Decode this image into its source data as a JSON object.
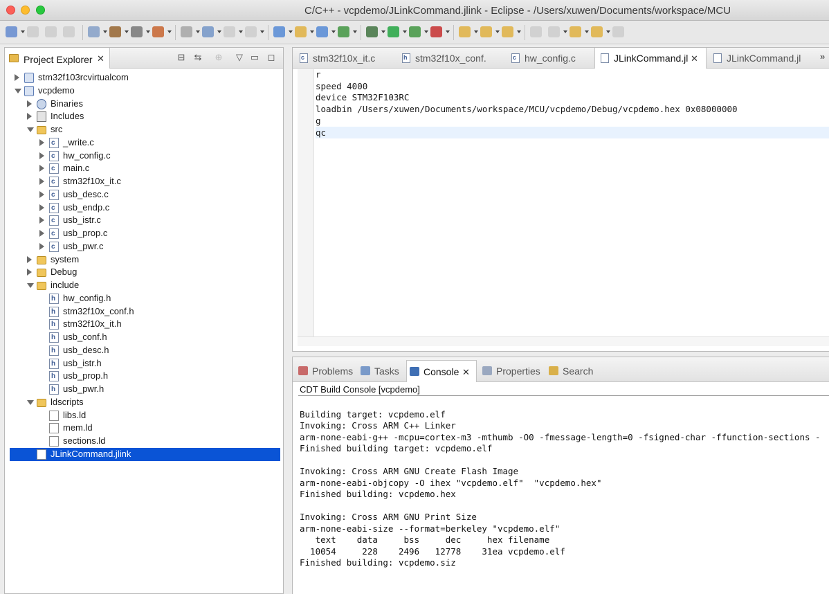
{
  "window": {
    "title": "C/C++ - vcpdemo/JLinkCommand.jlink - Eclipse - /Users/xuwen/Documents/workspace/MCU"
  },
  "toolbar": {
    "icons": [
      "new-icon",
      "save-icon",
      "save-all-icon",
      "print-icon",
      "build-settings-icon",
      "hammer-icon",
      "binary-icon",
      "module-icon",
      "connect-icon",
      "skip-breakpoints-icon",
      "view-icon",
      "panel-icon",
      "new-cpp-project-icon",
      "new-folder-icon",
      "new-class-icon",
      "refresh-icon",
      "debug-icon",
      "run-icon",
      "external-tools-icon",
      "stop-icon",
      "open-type-icon",
      "open-folder-icon",
      "search-icon",
      "annotation-icon",
      "next-annotation-icon",
      "back-icon",
      "forward-icon",
      "pin-icon"
    ]
  },
  "explorer": {
    "tab_label": "Project Explorer",
    "tree": [
      {
        "label": "stm32f103rcvirtualcom",
        "depth": 0,
        "icon": "project",
        "expand": "right"
      },
      {
        "label": "vcpdemo",
        "depth": 0,
        "icon": "project",
        "expand": "down"
      },
      {
        "label": "Binaries",
        "depth": 1,
        "icon": "binaries",
        "expand": "right"
      },
      {
        "label": "Includes",
        "depth": 1,
        "icon": "includes",
        "expand": "right"
      },
      {
        "label": "src",
        "depth": 1,
        "icon": "srcfolder",
        "expand": "down"
      },
      {
        "label": "_write.c",
        "depth": 2,
        "icon": "cfile",
        "expand": "right"
      },
      {
        "label": "hw_config.c",
        "depth": 2,
        "icon": "cfile",
        "expand": "right"
      },
      {
        "label": "main.c",
        "depth": 2,
        "icon": "cfile",
        "expand": "right"
      },
      {
        "label": "stm32f10x_it.c",
        "depth": 2,
        "icon": "cfile",
        "expand": "right"
      },
      {
        "label": "usb_desc.c",
        "depth": 2,
        "icon": "cfile",
        "expand": "right"
      },
      {
        "label": "usb_endp.c",
        "depth": 2,
        "icon": "cfile",
        "expand": "right"
      },
      {
        "label": "usb_istr.c",
        "depth": 2,
        "icon": "cfile",
        "expand": "right"
      },
      {
        "label": "usb_prop.c",
        "depth": 2,
        "icon": "cfile",
        "expand": "right"
      },
      {
        "label": "usb_pwr.c",
        "depth": 2,
        "icon": "cfile",
        "expand": "right"
      },
      {
        "label": "system",
        "depth": 1,
        "icon": "folder",
        "expand": "right"
      },
      {
        "label": "Debug",
        "depth": 1,
        "icon": "folder",
        "expand": "right"
      },
      {
        "label": "include",
        "depth": 1,
        "icon": "folder",
        "expand": "down"
      },
      {
        "label": "hw_config.h",
        "depth": 2,
        "icon": "hfile",
        "expand": "none"
      },
      {
        "label": "stm32f10x_conf.h",
        "depth": 2,
        "icon": "hfile",
        "expand": "none"
      },
      {
        "label": "stm32f10x_it.h",
        "depth": 2,
        "icon": "hfile",
        "expand": "none"
      },
      {
        "label": "usb_conf.h",
        "depth": 2,
        "icon": "hfile",
        "expand": "none"
      },
      {
        "label": "usb_desc.h",
        "depth": 2,
        "icon": "hfile",
        "expand": "none"
      },
      {
        "label": "usb_istr.h",
        "depth": 2,
        "icon": "hfile",
        "expand": "none"
      },
      {
        "label": "usb_prop.h",
        "depth": 2,
        "icon": "hfile",
        "expand": "none"
      },
      {
        "label": "usb_pwr.h",
        "depth": 2,
        "icon": "hfile",
        "expand": "none"
      },
      {
        "label": "ldscripts",
        "depth": 1,
        "icon": "folder",
        "expand": "down"
      },
      {
        "label": "libs.ld",
        "depth": 2,
        "icon": "file",
        "expand": "none"
      },
      {
        "label": "mem.ld",
        "depth": 2,
        "icon": "file",
        "expand": "none"
      },
      {
        "label": "sections.ld",
        "depth": 2,
        "icon": "file",
        "expand": "none"
      },
      {
        "label": "JLinkCommand.jlink",
        "depth": 1,
        "icon": "file",
        "expand": "none",
        "selected": true
      }
    ]
  },
  "editor": {
    "tabs": [
      {
        "label": "stm32f10x_it.c",
        "letter": "c",
        "active": false
      },
      {
        "label": "stm32f10x_conf.",
        "letter": "h",
        "active": false
      },
      {
        "label": "hw_config.c",
        "letter": "c",
        "active": false
      },
      {
        "label": "JLinkCommand.jl",
        "letter": "",
        "active": true
      },
      {
        "label": "JLinkCommand.jl",
        "letter": "",
        "active": false
      }
    ],
    "lines": [
      "r",
      "speed 4000",
      "device STM32F103RC",
      "loadbin /Users/xuwen/Documents/workspace/MCU/vcpdemo/Debug/vcpdemo.hex 0x08000000",
      "g",
      "qc"
    ],
    "current_line": 5
  },
  "console": {
    "tabs": [
      {
        "label": "Problems",
        "icon": "problems-icon",
        "active": false
      },
      {
        "label": "Tasks",
        "icon": "tasks-icon",
        "active": false
      },
      {
        "label": "Console",
        "icon": "console-icon",
        "active": true
      },
      {
        "label": "Properties",
        "icon": "properties-icon",
        "active": false
      },
      {
        "label": "Search",
        "icon": "search-icon",
        "active": false
      }
    ],
    "header": "CDT Build Console [vcpdemo]",
    "lines": [
      "",
      "Building target: vcpdemo.elf",
      "Invoking: Cross ARM C++ Linker",
      "arm-none-eabi-g++ -mcpu=cortex-m3 -mthumb -O0 -fmessage-length=0 -fsigned-char -ffunction-sections -",
      "Finished building target: vcpdemo.elf",
      "",
      "Invoking: Cross ARM GNU Create Flash Image",
      "arm-none-eabi-objcopy -O ihex \"vcpdemo.elf\"  \"vcpdemo.hex\"",
      "Finished building: vcpdemo.hex",
      "",
      "Invoking: Cross ARM GNU Print Size",
      "arm-none-eabi-size --format=berkeley \"vcpdemo.elf\"",
      "   text    data     bss     dec     hex filename",
      "  10054     228    2496   12778    31ea vcpdemo.elf",
      "Finished building: vcpdemo.siz"
    ]
  }
}
